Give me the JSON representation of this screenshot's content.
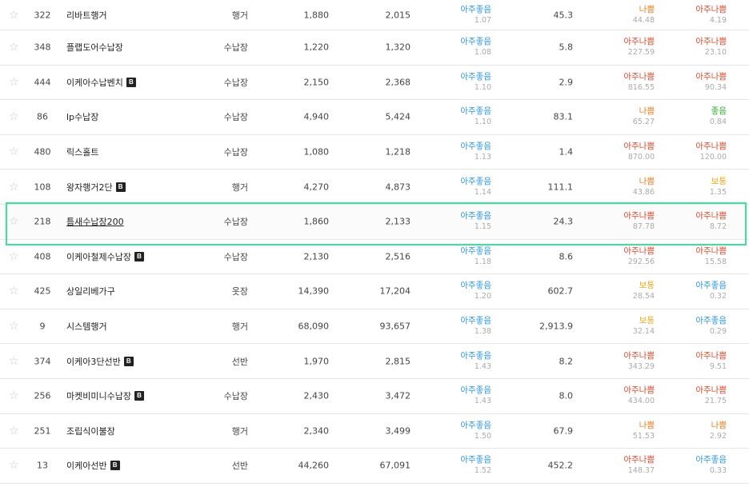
{
  "colors": {
    "very_good": "#2e97e8",
    "very_bad": "#e34a2e",
    "bad": "#ee7d1e",
    "good": "#2fae2f",
    "normal": "#f2a81c",
    "highlight_border": "#3be39a"
  },
  "icons": {
    "favorite": "star-outline-icon",
    "badge": "b-badge-icon"
  },
  "rows": [
    {
      "star": "☆",
      "rank": "322",
      "name": "리바트행거",
      "badge": "",
      "category": "행거",
      "n1": "1,880",
      "n2": "2,015",
      "g1": "아주좋음",
      "g1c": "c-vgood",
      "s1": "1.07",
      "val": "45.3",
      "g2": "나쁨",
      "g2c": "c-bad",
      "s2": "44.48",
      "g3": "아주나쁨",
      "g3c": "c-vbad",
      "s3": "4.19"
    },
    {
      "star": "☆",
      "rank": "348",
      "name": "플랩도어수납장",
      "badge": "",
      "category": "수납장",
      "n1": "1,220",
      "n2": "1,320",
      "g1": "아주좋음",
      "g1c": "c-vgood",
      "s1": "1.08",
      "val": "5.8",
      "g2": "아주나쁨",
      "g2c": "c-vbad",
      "s2": "227.59",
      "g3": "아주나쁨",
      "g3c": "c-vbad",
      "s3": "23.10"
    },
    {
      "star": "☆",
      "rank": "444",
      "name": "이케아수납벤치",
      "badge": "B",
      "category": "수납장",
      "n1": "2,150",
      "n2": "2,368",
      "g1": "아주좋음",
      "g1c": "c-vgood",
      "s1": "1.10",
      "val": "2.9",
      "g2": "아주나쁨",
      "g2c": "c-vbad",
      "s2": "816.55",
      "g3": "아주나쁨",
      "g3c": "c-vbad",
      "s3": "90.34"
    },
    {
      "star": "☆",
      "rank": "86",
      "name": "lp수납장",
      "badge": "",
      "category": "수납장",
      "n1": "4,940",
      "n2": "5,424",
      "g1": "아주좋음",
      "g1c": "c-vgood",
      "s1": "1.10",
      "val": "83.1",
      "g2": "나쁨",
      "g2c": "c-bad",
      "s2": "65.27",
      "g3": "좋음",
      "g3c": "c-good",
      "s3": "0.84"
    },
    {
      "star": "☆",
      "rank": "480",
      "name": "릭스홀트",
      "badge": "",
      "category": "수납장",
      "n1": "1,080",
      "n2": "1,218",
      "g1": "아주좋음",
      "g1c": "c-vgood",
      "s1": "1.13",
      "val": "1.4",
      "g2": "아주나쁨",
      "g2c": "c-vbad",
      "s2": "870.00",
      "g3": "아주나쁨",
      "g3c": "c-vbad",
      "s3": "120.00"
    },
    {
      "star": "☆",
      "rank": "108",
      "name": "왕자행거2단",
      "badge": "B",
      "category": "행거",
      "n1": "4,270",
      "n2": "4,873",
      "g1": "아주좋음",
      "g1c": "c-vgood",
      "s1": "1.14",
      "val": "111.1",
      "g2": "나쁨",
      "g2c": "c-bad",
      "s2": "43.86",
      "g3": "보통",
      "g3c": "c-norm",
      "s3": "1.35"
    },
    {
      "star": "☆",
      "rank": "218",
      "name": "틈새수납장200",
      "badge": "",
      "category": "수납장",
      "n1": "1,860",
      "n2": "2,133",
      "g1": "아주좋음",
      "g1c": "c-vgood",
      "s1": "1.15",
      "val": "24.3",
      "g2": "아주나쁨",
      "g2c": "c-vbad",
      "s2": "87.78",
      "g3": "아주나쁨",
      "g3c": "c-vbad",
      "s3": "8.72",
      "highlight": true
    },
    {
      "star": "☆",
      "rank": "408",
      "name": "이케아철제수납장",
      "badge": "B",
      "category": "수납장",
      "n1": "2,130",
      "n2": "2,516",
      "g1": "아주좋음",
      "g1c": "c-vgood",
      "s1": "1.18",
      "val": "8.6",
      "g2": "아주나쁨",
      "g2c": "c-vbad",
      "s2": "292.56",
      "g3": "아주나쁨",
      "g3c": "c-vbad",
      "s3": "15.58"
    },
    {
      "star": "☆",
      "rank": "425",
      "name": "상일리베가구",
      "badge": "",
      "category": "옷장",
      "n1": "14,390",
      "n2": "17,204",
      "g1": "아주좋음",
      "g1c": "c-vgood",
      "s1": "1.20",
      "val": "602.7",
      "g2": "보통",
      "g2c": "c-norm",
      "s2": "28.54",
      "g3": "아주좋음",
      "g3c": "c-vgood",
      "s3": "0.32"
    },
    {
      "star": "☆",
      "rank": "9",
      "name": "시스템행거",
      "badge": "",
      "category": "행거",
      "n1": "68,090",
      "n2": "93,657",
      "g1": "아주좋음",
      "g1c": "c-vgood",
      "s1": "1.38",
      "val": "2,913.9",
      "g2": "보통",
      "g2c": "c-norm",
      "s2": "32.14",
      "g3": "아주좋음",
      "g3c": "c-vgood",
      "s3": "0.29"
    },
    {
      "star": "☆",
      "rank": "374",
      "name": "이케아3단선반",
      "badge": "B",
      "category": "선반",
      "n1": "1,970",
      "n2": "2,815",
      "g1": "아주좋음",
      "g1c": "c-vgood",
      "s1": "1.43",
      "val": "8.2",
      "g2": "아주나쁨",
      "g2c": "c-vbad",
      "s2": "343.29",
      "g3": "아주나쁨",
      "g3c": "c-vbad",
      "s3": "9.51"
    },
    {
      "star": "☆",
      "rank": "256",
      "name": "마켓비미니수납장",
      "badge": "B",
      "category": "수납장",
      "n1": "2,430",
      "n2": "3,472",
      "g1": "아주좋음",
      "g1c": "c-vgood",
      "s1": "1.43",
      "val": "8.0",
      "g2": "아주나쁨",
      "g2c": "c-vbad",
      "s2": "434.00",
      "g3": "아주나쁨",
      "g3c": "c-vbad",
      "s3": "21.75"
    },
    {
      "star": "☆",
      "rank": "251",
      "name": "조립식이불장",
      "badge": "",
      "category": "행거",
      "n1": "2,340",
      "n2": "3,499",
      "g1": "아주좋음",
      "g1c": "c-vgood",
      "s1": "1.50",
      "val": "67.9",
      "g2": "나쁨",
      "g2c": "c-bad",
      "s2": "51.53",
      "g3": "나쁨",
      "g3c": "c-bad",
      "s3": "2.92"
    },
    {
      "star": "☆",
      "rank": "13",
      "name": "이케아선반",
      "badge": "B",
      "category": "선반",
      "n1": "44,260",
      "n2": "67,091",
      "g1": "아주좋음",
      "g1c": "c-vgood",
      "s1": "1.52",
      "val": "452.2",
      "g2": "아주나쁨",
      "g2c": "c-vbad",
      "s2": "148.37",
      "g3": "아주좋음",
      "g3c": "c-vgood",
      "s3": "0.33"
    }
  ]
}
